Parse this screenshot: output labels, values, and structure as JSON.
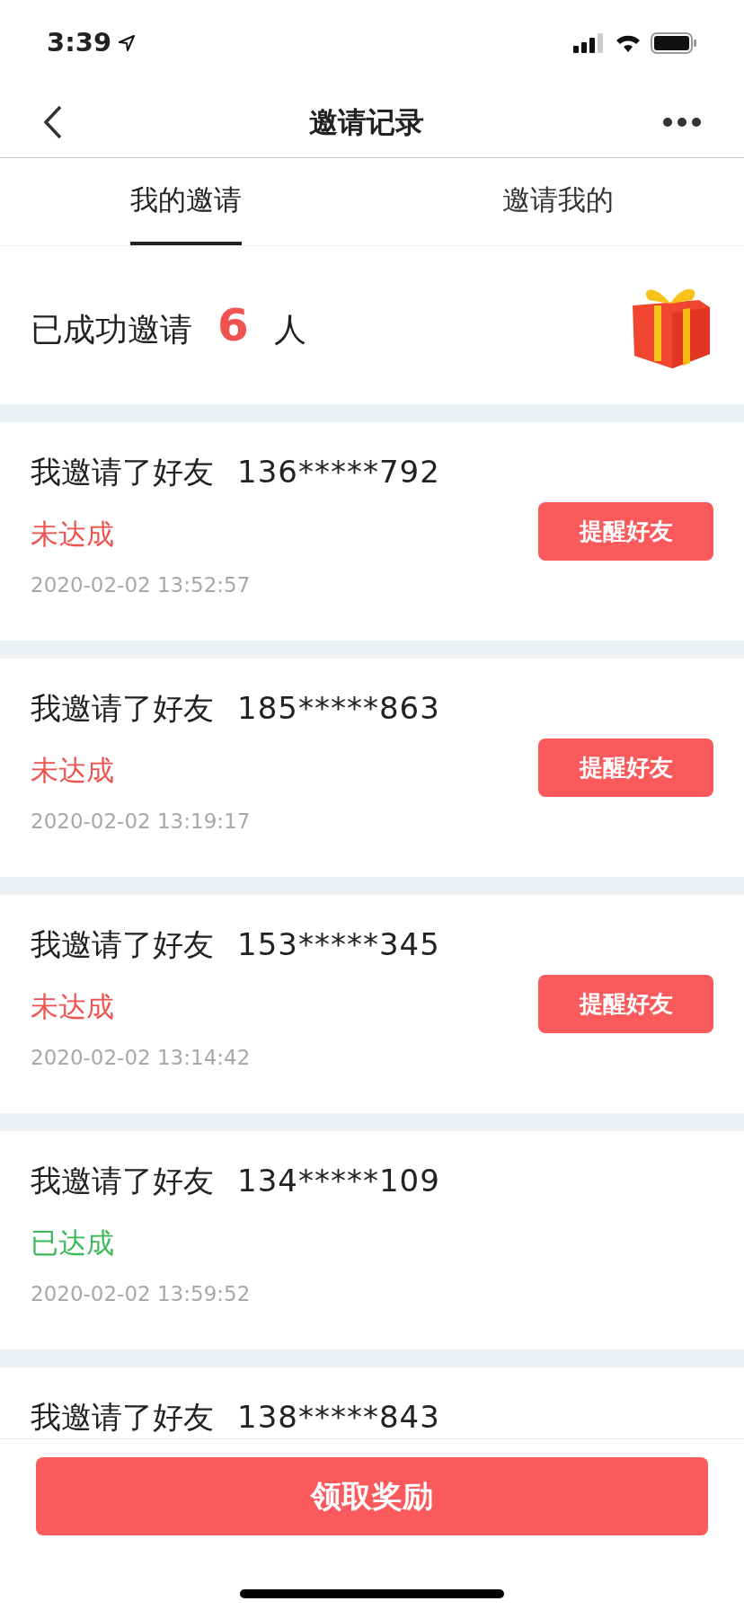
{
  "status_bar": {
    "time": "3:39"
  },
  "nav": {
    "title": "邀请记录"
  },
  "tabs": [
    {
      "label": "我的邀请",
      "selected": true
    },
    {
      "label": "邀请我的",
      "selected": false
    }
  ],
  "summary": {
    "prefix": "已成功邀请",
    "count": "6",
    "suffix": "人"
  },
  "invites": [
    {
      "text": "我邀请了好友",
      "phone": "136*****792",
      "status": "未达成",
      "achieved": false,
      "time": "2020-02-02 13:52:57",
      "button": "提醒好友"
    },
    {
      "text": "我邀请了好友",
      "phone": "185*****863",
      "status": "未达成",
      "achieved": false,
      "time": "2020-02-02 13:19:17",
      "button": "提醒好友"
    },
    {
      "text": "我邀请了好友",
      "phone": "153*****345",
      "status": "未达成",
      "achieved": false,
      "time": "2020-02-02 13:14:42",
      "button": "提醒好友"
    },
    {
      "text": "我邀请了好友",
      "phone": "134*****109",
      "status": "已达成",
      "achieved": true,
      "time": "2020-02-02 13:59:52"
    },
    {
      "text": "我邀请了好友",
      "phone": "138*****843"
    }
  ],
  "claim_button": "领取奖励"
}
